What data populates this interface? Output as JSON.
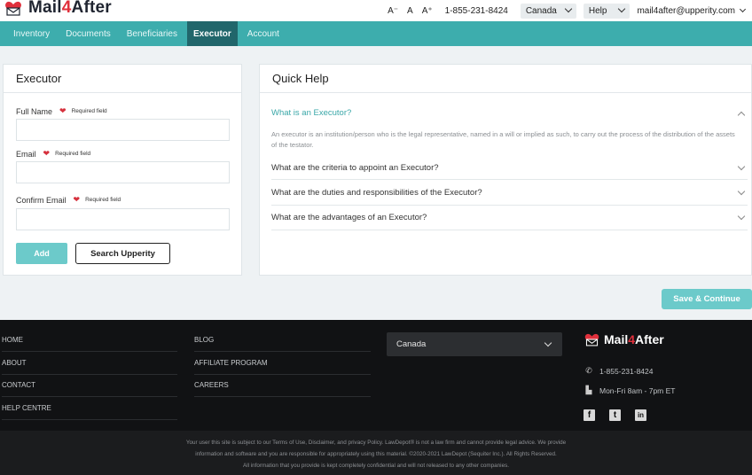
{
  "header": {
    "logo_prefix": "Mail",
    "logo_four": "4",
    "logo_suffix": "After",
    "font_small": "A⁻",
    "font_normal": "A",
    "font_large": "A⁺",
    "phone": "1-855-231-8424",
    "country": "Canada",
    "help": "Help",
    "user_email": "mail4after@upperity.com"
  },
  "nav": {
    "items": [
      "Inventory",
      "Documents",
      "Beneficiaries",
      "Executor",
      "Account"
    ],
    "active": "Executor"
  },
  "form": {
    "title": "Executor",
    "full_name_label": "Full Name",
    "email_label": "Email",
    "confirm_email_label": "Confirm Email",
    "required_text": "Required field",
    "full_name_value": "",
    "email_value": "",
    "confirm_email_value": "",
    "add_label": "Add",
    "search_label": "Search Upperity"
  },
  "help": {
    "title": "Quick Help",
    "items": [
      {
        "q": "What is an Executor?",
        "open": true,
        "a": "An executor is an institution/person who is the legal representative, named in a will or implied as such, to carry out the process of the distribution of the assets of the testator."
      },
      {
        "q": "What are the criteria to appoint an Executor?",
        "open": false
      },
      {
        "q": "What are the duties and responsibilities of the Executor?",
        "open": false
      },
      {
        "q": "What are the advantages of an Executor?",
        "open": false
      }
    ]
  },
  "save_label": "Save & Continue",
  "footer": {
    "col1": [
      "HOME",
      "ABOUT",
      "CONTACT",
      "HELP CENTRE"
    ],
    "col2": [
      "BLOG",
      "AFFILIATE PROGRAM",
      "CAREERS"
    ],
    "country": "Canada",
    "logo_prefix": "Mail",
    "logo_four": "4",
    "logo_suffix": "After",
    "phone": "1-855-231-8424",
    "hours": "Mon-Fri 8am - 7pm ET",
    "social": [
      "facebook-icon",
      "twitter-icon",
      "linkedin-icon"
    ],
    "legal_1": "Your user this site is subject to our Terms of Use, Disclaimer, and privacy Policy. LawDepot® is not a law firm and cannot provide legal advice. We provide",
    "legal_2": "information and software and you are responsible for appropriately using this material. ©2020-2021 LawDepot (Sequiter Inc.). All Rights Reserved.",
    "legal_3": "All information that you provide is kept completely confidential and will not released to any other companies."
  },
  "colors": {
    "teal": "#3dadad",
    "teal_dark": "#21666b",
    "button_teal": "#6ccaca",
    "heart_red": "#d6313d"
  }
}
